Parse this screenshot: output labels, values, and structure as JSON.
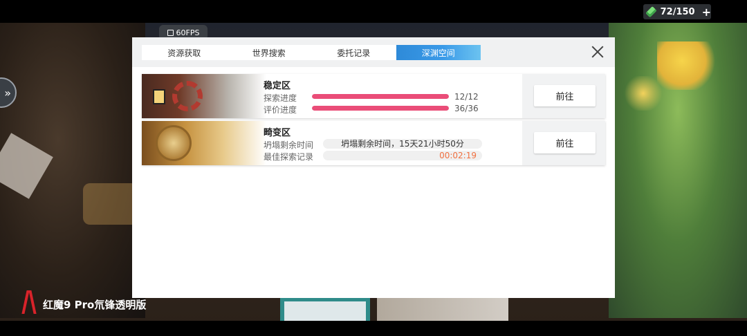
{
  "hud": {
    "fps_label": "60FPS",
    "stamina": "72/150",
    "stamina_icon": "green-crystal-icon",
    "plus": "+"
  },
  "side": {
    "icon": "double-chevron-icon",
    "glyph": "»"
  },
  "brand": {
    "text": "红魔9 Pro氘锋透明版"
  },
  "tabs": [
    {
      "label": "资源获取",
      "active": false
    },
    {
      "label": "世界搜索",
      "active": false
    },
    {
      "label": "委托记录",
      "active": false
    },
    {
      "label": "深渊空间",
      "active": true
    }
  ],
  "zones": [
    {
      "name": "稳定区",
      "explore_label": "探索进度",
      "explore_value": "12/12",
      "explore_progress": 1.0,
      "rating_label": "评价进度",
      "rating_value": "36/36",
      "rating_progress": 1.0,
      "action": "前往"
    },
    {
      "name": "畸变区",
      "collapse_label": "坍塌剩余时间",
      "collapse_value": "坍塌剩余时间，15天21小时50分",
      "best_label": "最佳探索记录",
      "best_value": "00:02:19",
      "action": "前往"
    }
  ],
  "colors": {
    "progress": "#ea4d78",
    "active_tab": "#2e8ad8",
    "record_time": "#f07040"
  }
}
